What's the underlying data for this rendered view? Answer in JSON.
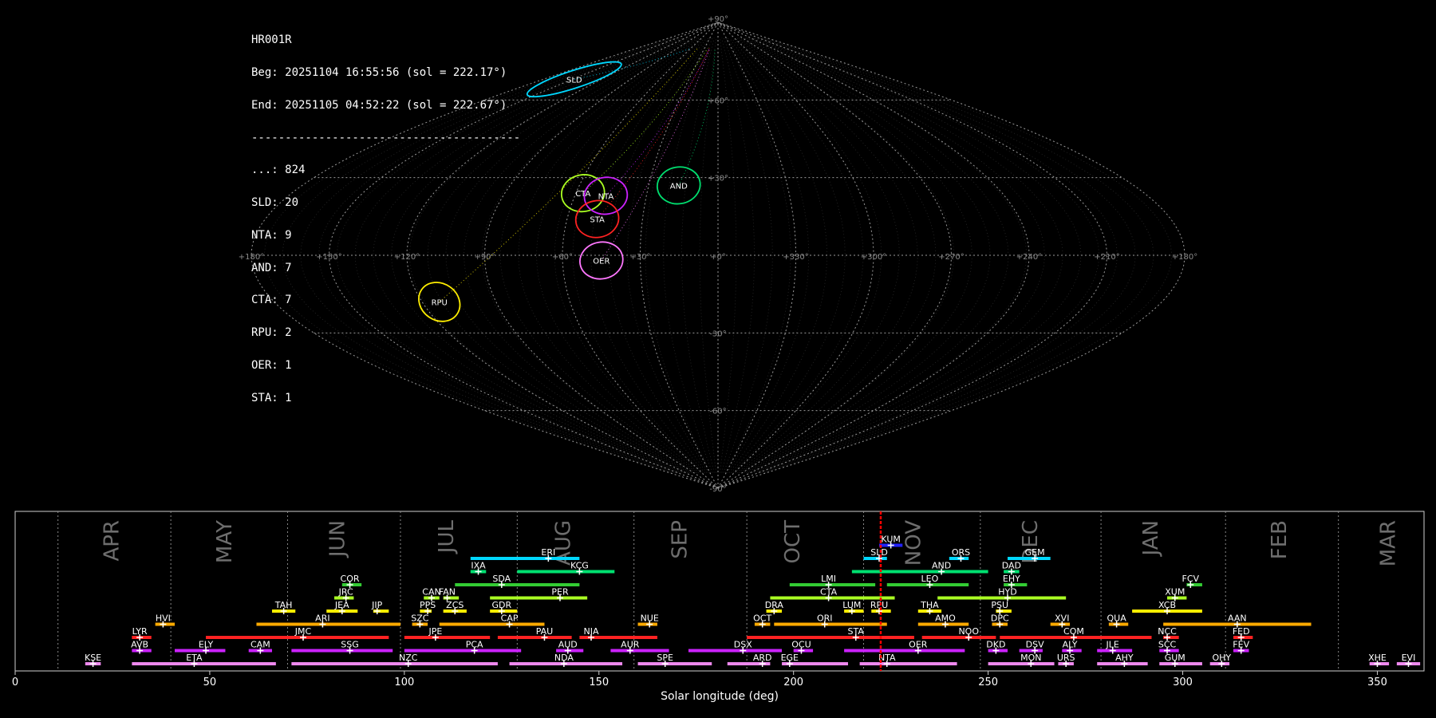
{
  "info": {
    "camera": "HR001R",
    "begin": "Beg: 20251104 16:55:56 (sol = 222.17°)",
    "end": "End: 20251105 04:52:22 (sol = 222.67°)",
    "separator": "----------------------------------------",
    "counts": [
      "...: 824",
      "SLD: 20",
      "NTA: 9",
      "AND: 7",
      "CTA: 7",
      "RPU: 2",
      "OER: 1",
      "STA: 1"
    ]
  },
  "sky_map": {
    "lon_labels": [
      "+180°",
      "+150°",
      "+120°",
      "+90°",
      "+60°",
      "+30°",
      "+0°",
      "+330°",
      "+300°",
      "+270°",
      "+240°",
      "+210°",
      "+180°"
    ],
    "lat_labels": [
      "+90°",
      "+60°",
      "+30°",
      "-30°",
      "-60°",
      "-90°"
    ],
    "radiants": [
      {
        "name": "SLD",
        "lon": 148,
        "lat": 68,
        "color": "#00d8ff"
      },
      {
        "name": "CTA",
        "lon": 57,
        "lat": 24,
        "color": "#aaff22"
      },
      {
        "name": "NTA",
        "lon": 47,
        "lat": 23,
        "color": "#cc22ff"
      },
      {
        "name": "STA",
        "lon": 48,
        "lat": 14,
        "color": "#ff2222"
      },
      {
        "name": "AND",
        "lon": 17,
        "lat": 27,
        "color": "#00e070"
      },
      {
        "name": "OER",
        "lon": 45,
        "lat": -2,
        "color": "#ff77ff"
      },
      {
        "name": "RPU",
        "lon": 113,
        "lat": -18,
        "color": "#ffee00"
      }
    ]
  },
  "chart_data": {
    "type": "timeline",
    "xlabel": "Solar longitude (deg)",
    "xlim": [
      0,
      362
    ],
    "xticks": [
      0,
      50,
      100,
      150,
      200,
      250,
      300,
      350
    ],
    "month_boundaries": [
      11,
      40,
      70,
      99,
      129,
      159,
      188,
      218,
      248,
      279,
      311,
      340
    ],
    "months": [
      {
        "name": "APR",
        "x": 25
      },
      {
        "name": "MAY",
        "x": 54
      },
      {
        "name": "JUN",
        "x": 83
      },
      {
        "name": "JUL",
        "x": 111
      },
      {
        "name": "AUG",
        "x": 141
      },
      {
        "name": "SEP",
        "x": 171
      },
      {
        "name": "OCT",
        "x": 200
      },
      {
        "name": "NOV",
        "x": 231
      },
      {
        "name": "DEC",
        "x": 261
      },
      {
        "name": "JAN",
        "x": 292
      },
      {
        "name": "FEB",
        "x": 325
      },
      {
        "name": "MAR",
        "x": 353
      }
    ],
    "current_sol": 222.4,
    "showers": [
      {
        "code": "KUM",
        "start": 222,
        "end": 228,
        "peak": 225,
        "row": 9,
        "color": "#2222ff"
      },
      {
        "code": "ERI",
        "start": 117,
        "end": 145,
        "peak": 137,
        "row": 8,
        "color": "#00d8ff"
      },
      {
        "code": "SLD",
        "start": 218,
        "end": 224,
        "peak": 222,
        "row": 8,
        "color": "#00d8ff"
      },
      {
        "code": "ORS",
        "start": 240,
        "end": 245,
        "peak": 243,
        "row": 8,
        "color": "#00d8ff"
      },
      {
        "code": "GEM",
        "start": 255,
        "end": 266,
        "peak": 262,
        "row": 8,
        "color": "#00d8ff"
      },
      {
        "code": "IXA",
        "start": 117,
        "end": 121,
        "peak": 119,
        "row": 7,
        "color": "#00e070"
      },
      {
        "code": "KCG",
        "start": 129,
        "end": 154,
        "peak": 145,
        "row": 7,
        "color": "#00e070"
      },
      {
        "code": "AND",
        "start": 215,
        "end": 250,
        "peak": 238,
        "row": 7,
        "color": "#00e070"
      },
      {
        "code": "DAD",
        "start": 254,
        "end": 258,
        "peak": 256,
        "row": 7,
        "color": "#00e070"
      },
      {
        "code": "SDA",
        "start": 113,
        "end": 145,
        "peak": 125,
        "row": 6,
        "color": "#33cc33"
      },
      {
        "code": "LMI",
        "start": 199,
        "end": 221,
        "peak": 209,
        "row": 6,
        "color": "#33cc33"
      },
      {
        "code": "LEO",
        "start": 224,
        "end": 245,
        "peak": 235,
        "row": 6,
        "color": "#33cc33"
      },
      {
        "code": "COR",
        "start": 84,
        "end": 89,
        "peak": 86,
        "row": 6,
        "color": "#33cc33"
      },
      {
        "code": "EHY",
        "start": 254,
        "end": 260,
        "peak": 256,
        "row": 6,
        "color": "#33cc33"
      },
      {
        "code": "FCV",
        "start": 301,
        "end": 305,
        "peak": 302,
        "row": 6,
        "color": "#33cc33"
      },
      {
        "code": "JRC",
        "start": 82,
        "end": 87,
        "peak": 85,
        "row": 5,
        "color": "#aaff22"
      },
      {
        "code": "CAN",
        "start": 105,
        "end": 109,
        "peak": 107,
        "row": 5,
        "color": "#aaff22"
      },
      {
        "code": "FAN",
        "start": 110,
        "end": 114,
        "peak": 111,
        "row": 5,
        "color": "#aaff22"
      },
      {
        "code": "PER",
        "start": 122,
        "end": 147,
        "peak": 140,
        "row": 5,
        "color": "#aaff22"
      },
      {
        "code": "CTA",
        "start": 194,
        "end": 226,
        "peak": 209,
        "row": 5,
        "color": "#aaff22"
      },
      {
        "code": "HYD",
        "start": 237,
        "end": 270,
        "peak": 255,
        "row": 5,
        "color": "#aaff22"
      },
      {
        "code": "XUM",
        "start": 296,
        "end": 301,
        "peak": 298,
        "row": 5,
        "color": "#aaff22"
      },
      {
        "code": "TAH",
        "start": 66,
        "end": 72,
        "peak": 69,
        "row": 4,
        "color": "#ffee00"
      },
      {
        "code": "JEA",
        "start": 80,
        "end": 88,
        "peak": 84,
        "row": 4,
        "color": "#ffee00"
      },
      {
        "code": "JIP",
        "start": 92,
        "end": 96,
        "peak": 93,
        "row": 4,
        "color": "#ffee00"
      },
      {
        "code": "PPS",
        "start": 104,
        "end": 107,
        "peak": 106,
        "row": 4,
        "color": "#ffee00"
      },
      {
        "code": "ZCS",
        "start": 110,
        "end": 116,
        "peak": 113,
        "row": 4,
        "color": "#ffee00"
      },
      {
        "code": "GDR",
        "start": 122,
        "end": 129,
        "peak": 125,
        "row": 4,
        "color": "#ffee00"
      },
      {
        "code": "DRA",
        "start": 193,
        "end": 197,
        "peak": 195,
        "row": 4,
        "color": "#ffee00"
      },
      {
        "code": "LUM",
        "start": 213,
        "end": 218,
        "peak": 215,
        "row": 4,
        "color": "#ffee00"
      },
      {
        "code": "RPU",
        "start": 220,
        "end": 225,
        "peak": 222,
        "row": 4,
        "color": "#ffee00"
      },
      {
        "code": "THA",
        "start": 232,
        "end": 238,
        "peak": 235,
        "row": 4,
        "color": "#ffee00"
      },
      {
        "code": "PSU",
        "start": 252,
        "end": 256,
        "peak": 253,
        "row": 4,
        "color": "#ffee00"
      },
      {
        "code": "XCB",
        "start": 287,
        "end": 305,
        "peak": 296,
        "row": 4,
        "color": "#ffee00"
      },
      {
        "code": "HVI",
        "start": 36,
        "end": 41,
        "peak": 38,
        "row": 3,
        "color": "#ffaa00"
      },
      {
        "code": "ARI",
        "start": 62,
        "end": 99,
        "peak": 79,
        "row": 3,
        "color": "#ffaa00"
      },
      {
        "code": "SZC",
        "start": 102,
        "end": 106,
        "peak": 104,
        "row": 3,
        "color": "#ffaa00"
      },
      {
        "code": "CAP",
        "start": 109,
        "end": 136,
        "peak": 127,
        "row": 3,
        "color": "#ffaa00"
      },
      {
        "code": "NUE",
        "start": 160,
        "end": 165,
        "peak": 163,
        "row": 3,
        "color": "#ffaa00"
      },
      {
        "code": "OCT",
        "start": 190,
        "end": 194,
        "peak": 192,
        "row": 3,
        "color": "#ffaa00"
      },
      {
        "code": "ORI",
        "start": 195,
        "end": 224,
        "peak": 208,
        "row": 3,
        "color": "#ffaa00"
      },
      {
        "code": "AMO",
        "start": 232,
        "end": 245,
        "peak": 239,
        "row": 3,
        "color": "#ffaa00"
      },
      {
        "code": "DPC",
        "start": 251,
        "end": 255,
        "peak": 253,
        "row": 3,
        "color": "#ffaa00"
      },
      {
        "code": "XVI",
        "start": 266,
        "end": 271,
        "peak": 269,
        "row": 3,
        "color": "#ffaa00"
      },
      {
        "code": "QUA",
        "start": 281,
        "end": 286,
        "peak": 283,
        "row": 3,
        "color": "#ffaa00"
      },
      {
        "code": "AAN",
        "start": 295,
        "end": 333,
        "peak": 314,
        "row": 3,
        "color": "#ffaa00"
      },
      {
        "code": "LYR",
        "start": 30,
        "end": 35,
        "peak": 32,
        "row": 2,
        "color": "#ff2222"
      },
      {
        "code": "JMC",
        "start": 49,
        "end": 96,
        "peak": 74,
        "row": 2,
        "color": "#ff2222"
      },
      {
        "code": "JPE",
        "start": 100,
        "end": 122,
        "peak": 108,
        "row": 2,
        "color": "#ff2222"
      },
      {
        "code": "PAU",
        "start": 124,
        "end": 143,
        "peak": 136,
        "row": 2,
        "color": "#ff2222"
      },
      {
        "code": "NIA",
        "start": 145,
        "end": 165,
        "peak": 148,
        "row": 2,
        "color": "#ff2222"
      },
      {
        "code": "STA",
        "start": 188,
        "end": 231,
        "peak": 216,
        "row": 2,
        "color": "#ff2222"
      },
      {
        "code": "NOO",
        "start": 233,
        "end": 252,
        "peak": 245,
        "row": 2,
        "color": "#ff2222"
      },
      {
        "code": "COM",
        "start": 253,
        "end": 292,
        "peak": 272,
        "row": 2,
        "color": "#ff2222"
      },
      {
        "code": "NCC",
        "start": 295,
        "end": 299,
        "peak": 296,
        "row": 2,
        "color": "#ff2222"
      },
      {
        "code": "FED",
        "start": 313,
        "end": 318,
        "peak": 315,
        "row": 2,
        "color": "#ff2222"
      },
      {
        "code": "AVB",
        "start": 30,
        "end": 35,
        "peak": 32,
        "row": 1,
        "color": "#cc22ff"
      },
      {
        "code": "ELY",
        "start": 41,
        "end": 54,
        "peak": 49,
        "row": 1,
        "color": "#cc22ff"
      },
      {
        "code": "CAM",
        "start": 60,
        "end": 66,
        "peak": 63,
        "row": 1,
        "color": "#cc22ff"
      },
      {
        "code": "SSG",
        "start": 71,
        "end": 97,
        "peak": 86,
        "row": 1,
        "color": "#cc22ff"
      },
      {
        "code": "PCA",
        "start": 100,
        "end": 130,
        "peak": 118,
        "row": 1,
        "color": "#cc22ff"
      },
      {
        "code": "AUD",
        "start": 139,
        "end": 146,
        "peak": 142,
        "row": 1,
        "color": "#cc22ff"
      },
      {
        "code": "AUR",
        "start": 153,
        "end": 168,
        "peak": 158,
        "row": 1,
        "color": "#cc22ff"
      },
      {
        "code": "DSX",
        "start": 173,
        "end": 197,
        "peak": 187,
        "row": 1,
        "color": "#cc22ff"
      },
      {
        "code": "OCU",
        "start": 200,
        "end": 205,
        "peak": 202,
        "row": 1,
        "color": "#cc22ff"
      },
      {
        "code": "OER",
        "start": 213,
        "end": 244,
        "peak": 232,
        "row": 1,
        "color": "#cc22ff"
      },
      {
        "code": "DKD",
        "start": 250,
        "end": 255,
        "peak": 252,
        "row": 1,
        "color": "#cc22ff"
      },
      {
        "code": "DSV",
        "start": 258,
        "end": 264,
        "peak": 262,
        "row": 1,
        "color": "#cc22ff"
      },
      {
        "code": "ALY",
        "start": 269,
        "end": 274,
        "peak": 271,
        "row": 1,
        "color": "#cc22ff"
      },
      {
        "code": "JLE",
        "start": 278,
        "end": 287,
        "peak": 282,
        "row": 1,
        "color": "#cc22ff"
      },
      {
        "code": "SCC",
        "start": 294,
        "end": 299,
        "peak": 296,
        "row": 1,
        "color": "#cc22ff"
      },
      {
        "code": "FEV",
        "start": 313,
        "end": 317,
        "peak": 315,
        "row": 1,
        "color": "#cc22ff"
      },
      {
        "code": "KSE",
        "start": 18,
        "end": 22,
        "peak": 20,
        "row": 0,
        "color": "#ee88ee"
      },
      {
        "code": "ETA",
        "start": 30,
        "end": 67,
        "peak": 46,
        "row": 0,
        "color": "#ee88ee"
      },
      {
        "code": "NZC",
        "start": 71,
        "end": 124,
        "peak": 101,
        "row": 0,
        "color": "#ee88ee"
      },
      {
        "code": "NDA",
        "start": 127,
        "end": 156,
        "peak": 141,
        "row": 0,
        "color": "#ee88ee"
      },
      {
        "code": "SPE",
        "start": 160,
        "end": 179,
        "peak": 167,
        "row": 0,
        "color": "#ee88ee"
      },
      {
        "code": "ARD",
        "start": 183,
        "end": 194,
        "peak": 192,
        "row": 0,
        "color": "#ee88ee"
      },
      {
        "code": "EGE",
        "start": 197,
        "end": 214,
        "peak": 199,
        "row": 0,
        "color": "#ee88ee"
      },
      {
        "code": "NTA",
        "start": 217,
        "end": 242,
        "peak": 224,
        "row": 0,
        "color": "#ee88ee"
      },
      {
        "code": "MON",
        "start": 250,
        "end": 267,
        "peak": 261,
        "row": 0,
        "color": "#ee88ee"
      },
      {
        "code": "URS",
        "start": 268,
        "end": 272,
        "peak": 270,
        "row": 0,
        "color": "#ee88ee"
      },
      {
        "code": "AHY",
        "start": 278,
        "end": 291,
        "peak": 285,
        "row": 0,
        "color": "#ee88ee"
      },
      {
        "code": "GUM",
        "start": 294,
        "end": 305,
        "peak": 298,
        "row": 0,
        "color": "#ee88ee"
      },
      {
        "code": "OHY",
        "start": 307,
        "end": 312,
        "peak": 310,
        "row": 0,
        "color": "#ee88ee"
      },
      {
        "code": "XHE",
        "start": 348,
        "end": 353,
        "peak": 350,
        "row": 0,
        "color": "#ee88ee"
      },
      {
        "code": "EVI",
        "start": 355,
        "end": 361,
        "peak": 358,
        "row": 0,
        "color": "#ee88ee"
      }
    ]
  }
}
